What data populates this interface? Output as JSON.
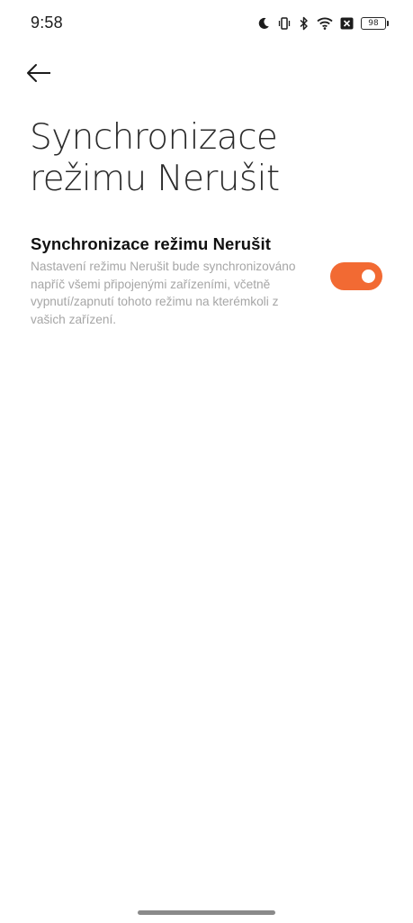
{
  "status_bar": {
    "time": "9:58",
    "icons": [
      "moon-icon",
      "vibrate-icon",
      "bluetooth-icon",
      "wifi-icon",
      "no-sim-icon",
      "battery-icon"
    ],
    "battery_level": "98"
  },
  "header": {
    "back_icon": "arrow-left-icon",
    "title": "Synchronizace režimu Nerušit"
  },
  "setting": {
    "title": "Synchronizace režimu Nerušit",
    "description": "Nastavení režimu Nerušit bude synchronizováno napříč všemi připojenými zařízeními, včetně vypnutí/zapnutí tohoto režimu na kterémkoli z vašich zařízení.",
    "enabled": true,
    "toggle_color": "#f26a33"
  }
}
